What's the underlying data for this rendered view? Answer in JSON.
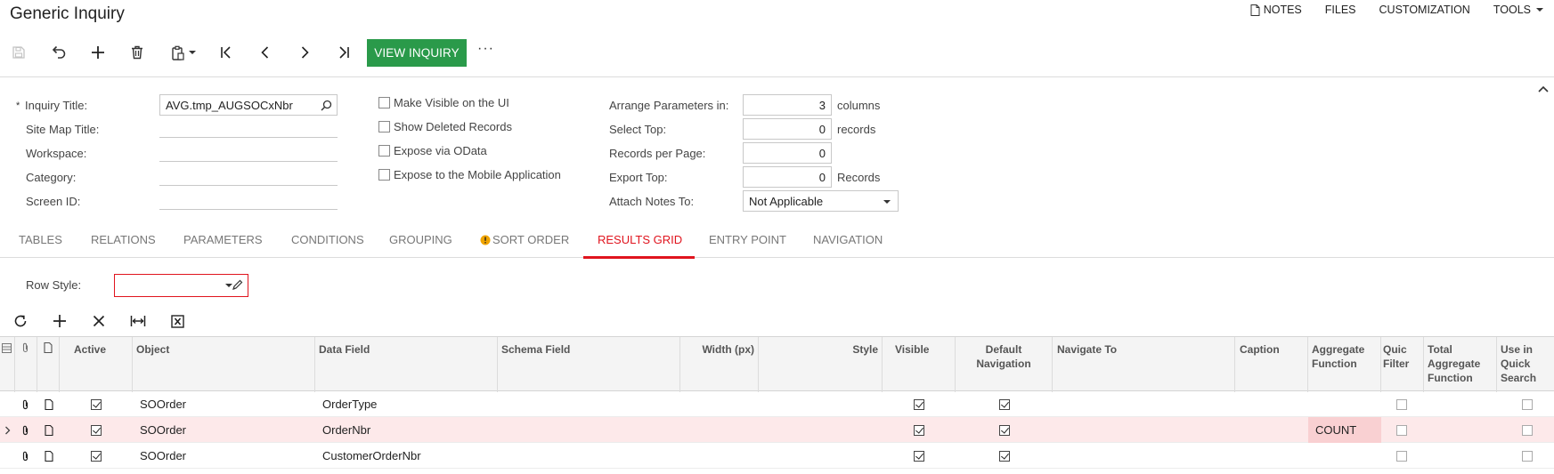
{
  "app": {
    "title": "Generic Inquiry"
  },
  "topmenu": {
    "notes": "NOTES",
    "files": "FILES",
    "customization": "CUSTOMIZATION",
    "tools": "TOOLS"
  },
  "toolbar": {
    "view_inquiry": "VIEW INQUIRY",
    "more": "···"
  },
  "form": {
    "inquiry_title_label": "Inquiry Title:",
    "inquiry_title_value": "AVG.tmp_AUGSOCxNbr",
    "site_map_title_label": "Site Map Title:",
    "workspace_label": "Workspace:",
    "category_label": "Category:",
    "screen_id_label": "Screen ID:",
    "required_mark": "*",
    "make_visible": "Make Visible on the UI",
    "show_deleted": "Show Deleted Records",
    "expose_odata": "Expose via OData",
    "expose_mobile": "Expose to the Mobile Application",
    "arrange_label": "Arrange Parameters in:",
    "arrange_value": "3",
    "arrange_unit": "columns",
    "select_top_label": "Select Top:",
    "select_top_value": "0",
    "select_top_unit": "records",
    "records_per_page_label": "Records per Page:",
    "records_per_page_value": "0",
    "export_top_label": "Export Top:",
    "export_top_value": "0",
    "export_top_unit": "Records",
    "attach_notes_label": "Attach Notes To:",
    "attach_notes_value": "Not Applicable"
  },
  "tabs": [
    "TABLES",
    "RELATIONS",
    "PARAMETERS",
    "CONDITIONS",
    "GROUPING",
    "SORT ORDER",
    "RESULTS GRID",
    "ENTRY POINT",
    "NAVIGATION"
  ],
  "results": {
    "row_style_label": "Row Style:"
  },
  "grid": {
    "headers": {
      "active": "Active",
      "object": "Object",
      "data_field": "Data Field",
      "schema_field": "Schema Field",
      "width": "Width (px)",
      "style": "Style",
      "visible": "Visible",
      "default_nav": "Default Navigation",
      "navigate_to": "Navigate To",
      "caption": "Caption",
      "aggregate": "Aggregate Function",
      "quick_filter": "Quic Filter",
      "total_aggregate": "Total Aggregate Function",
      "quick_search": "Use in Quick Search"
    },
    "rows": [
      {
        "object": "SOOrder",
        "data_field": "OrderType",
        "aggregate": ""
      },
      {
        "object": "SOOrder",
        "data_field": "OrderNbr",
        "aggregate": "COUNT"
      },
      {
        "object": "SOOrder",
        "data_field": "CustomerOrderNbr",
        "aggregate": ""
      }
    ]
  },
  "colors": {
    "accent": "#e0141e",
    "view_button": "#2a9a4a",
    "selected_row": "#fde9ea"
  }
}
